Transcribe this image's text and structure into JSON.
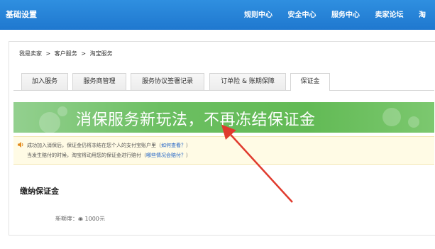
{
  "header": {
    "title": "基础设置",
    "nav": [
      "规则中心",
      "安全中心",
      "服务中心",
      "卖家论坛",
      "淘"
    ]
  },
  "breadcrumb": {
    "items": [
      "我是卖家",
      "客户服务",
      "淘宝服务"
    ],
    "separator": ">"
  },
  "tabs": [
    {
      "label": "加入服务"
    },
    {
      "label": "服务商管理"
    },
    {
      "label": "服务协议签署记录"
    },
    {
      "label": "订单险 & 账期保障"
    },
    {
      "label": "保证金"
    }
  ],
  "active_tab": "保证金",
  "banner": {
    "text": "消保服务新玩法，不再冻结保证金"
  },
  "notice": {
    "line1_text": "成功加入消保后，保证金仍将冻结在您个人的支付宝账户里（",
    "line1_link": "如何查看？",
    "line1_end": "）",
    "line2_text": "当发生赔付的时候，淘宝将动用您的保证金进行赔付（",
    "line2_link": "哪些情况会赔付？",
    "line2_end": "）"
  },
  "section": {
    "title": "缴纳保证金",
    "partial_row": "新额度：◉ 1000元"
  },
  "colors": {
    "topbar": "#1f78cf",
    "banner": "#62ba55",
    "notice_bg": "#fffbe5",
    "link": "#1f62c6",
    "arrow": "#e03b2e"
  },
  "icons": [
    "speaker-icon",
    "arrow-annotation"
  ]
}
